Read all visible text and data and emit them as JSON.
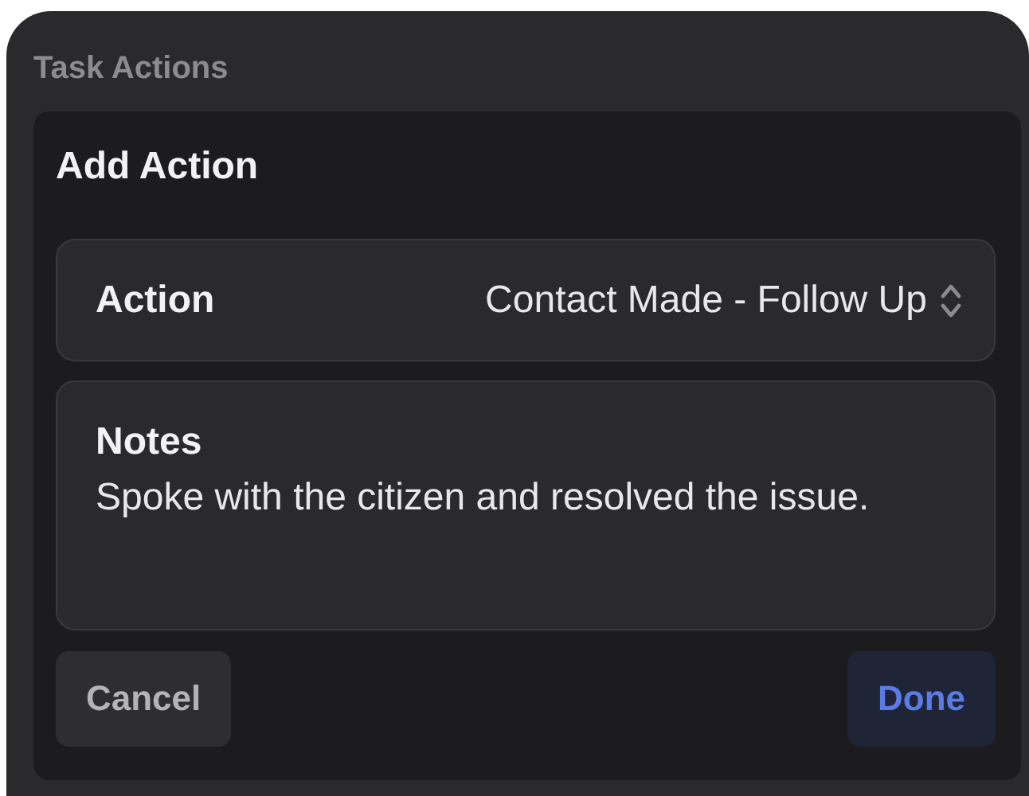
{
  "window": {
    "title": "Task Actions"
  },
  "dialog": {
    "title": "Add Action",
    "action": {
      "label": "Action",
      "value": "Contact Made - Follow Up"
    },
    "notes": {
      "label": "Notes",
      "value": "Spoke with the citizen and resolved the issue."
    },
    "buttons": [
      {
        "label": "Cancel",
        "kind": "secondary"
      },
      {
        "label": "Done",
        "kind": "primary"
      }
    ]
  }
}
